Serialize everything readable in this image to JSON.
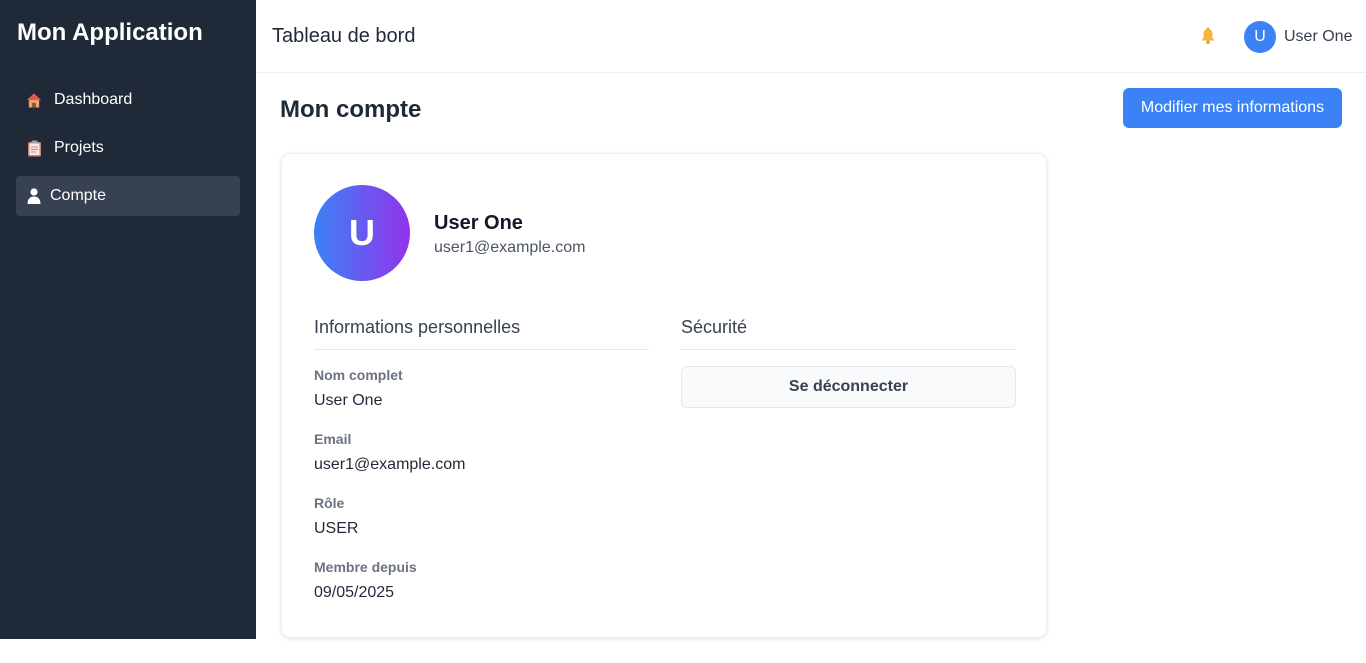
{
  "app": {
    "title": "Mon Application"
  },
  "sidebar": {
    "items": [
      {
        "label": "Dashboard",
        "icon": "house-icon",
        "active": false
      },
      {
        "label": "Projets",
        "icon": "clipboard-icon",
        "active": false
      },
      {
        "label": "Compte",
        "icon": "user-icon",
        "active": true
      }
    ]
  },
  "header": {
    "title": "Tableau de bord",
    "avatar_initial": "U",
    "username": "User One",
    "notification_icon": "bell-icon"
  },
  "page": {
    "title": "Mon compte",
    "edit_button_label": "Modifier mes informations"
  },
  "profile": {
    "avatar_initial": "U",
    "name": "User One",
    "email": "user1@example.com"
  },
  "personal_info": {
    "heading": "Informations personnelles",
    "fields": [
      {
        "label": "Nom complet",
        "value": "User One"
      },
      {
        "label": "Email",
        "value": "user1@example.com"
      },
      {
        "label": "Rôle",
        "value": "USER"
      },
      {
        "label": "Membre depuis",
        "value": "09/05/2025"
      }
    ]
  },
  "security": {
    "heading": "Sécurité",
    "logout_label": "Se déconnecter"
  },
  "colors": {
    "sidebar_bg": "#1f2937",
    "sidebar_active": "#374151",
    "accent": "#3b82f6",
    "avatar_gradient_end": "#9333ea"
  }
}
